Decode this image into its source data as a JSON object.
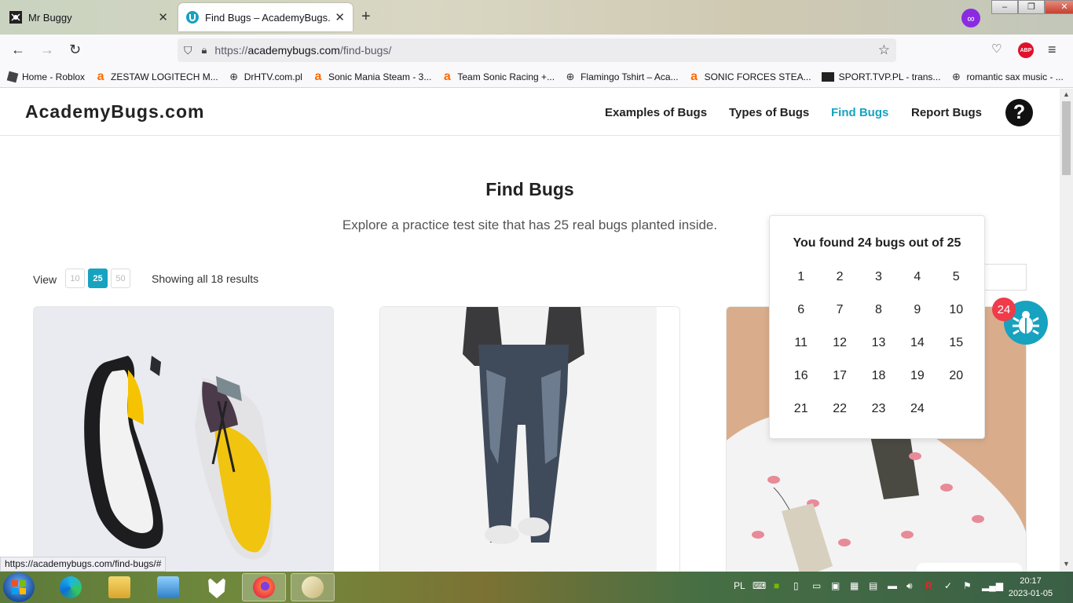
{
  "browser": {
    "tabs": [
      {
        "title": "Mr Buggy",
        "active": false
      },
      {
        "title": "Find Bugs – AcademyBugs.com",
        "active": true
      }
    ],
    "url_prefix": "https://",
    "url_host": "academybugs.com",
    "url_path": "/find-bugs/",
    "abp_label": "ABP",
    "bookmarks": [
      {
        "label": "Home - Roblox",
        "icon": "roblox-icon"
      },
      {
        "label": "ZESTAW LOGITECH M...",
        "icon": "amazon-icon"
      },
      {
        "label": "DrHTV.com.pl",
        "icon": "globe-icon"
      },
      {
        "label": "Sonic Mania Steam - 3...",
        "icon": "amazon-icon"
      },
      {
        "label": "Team Sonic Racing +...",
        "icon": "amazon-icon"
      },
      {
        "label": "Flamingo Tshirt – Aca...",
        "icon": "globe-icon"
      },
      {
        "label": "SONIC FORCES STEA...",
        "icon": "amazon-icon"
      },
      {
        "label": "SPORT.TVP.PL - trans...",
        "icon": "tvp-icon"
      },
      {
        "label": "romantic sax music - ...",
        "icon": "globe-icon"
      }
    ],
    "status_url": "https://academybugs.com/find-bugs/#"
  },
  "site": {
    "logo": "AcademyBugs.com",
    "menu": [
      "Examples of Bugs",
      "Types of Bugs",
      "Find Bugs",
      "Report Bugs"
    ],
    "active_menu": "Find Bugs",
    "help_label": "?"
  },
  "main": {
    "title": "Find Bugs",
    "subtitle": "Explore a practice test site that has 25 real bugs planted inside.",
    "view_label": "View",
    "page_sizes": [
      "10",
      "25",
      "50"
    ],
    "selected_page_size": "25",
    "results_text": "Showing all 18 results"
  },
  "bug_tracker": {
    "found_text": "You found 24 bugs out of 25",
    "found_numbers": [
      "1",
      "2",
      "3",
      "4",
      "5",
      "6",
      "7",
      "8",
      "9",
      "10",
      "11",
      "12",
      "13",
      "14",
      "15",
      "16",
      "17",
      "18",
      "19",
      "20",
      "21",
      "22",
      "23",
      "24"
    ],
    "badge_count": "24"
  },
  "taskbar": {
    "lang": "PL",
    "time": "20:17",
    "date": "2023-01-05"
  },
  "colors": {
    "accent": "#17a2c0",
    "badge": "#ef3b4a"
  }
}
